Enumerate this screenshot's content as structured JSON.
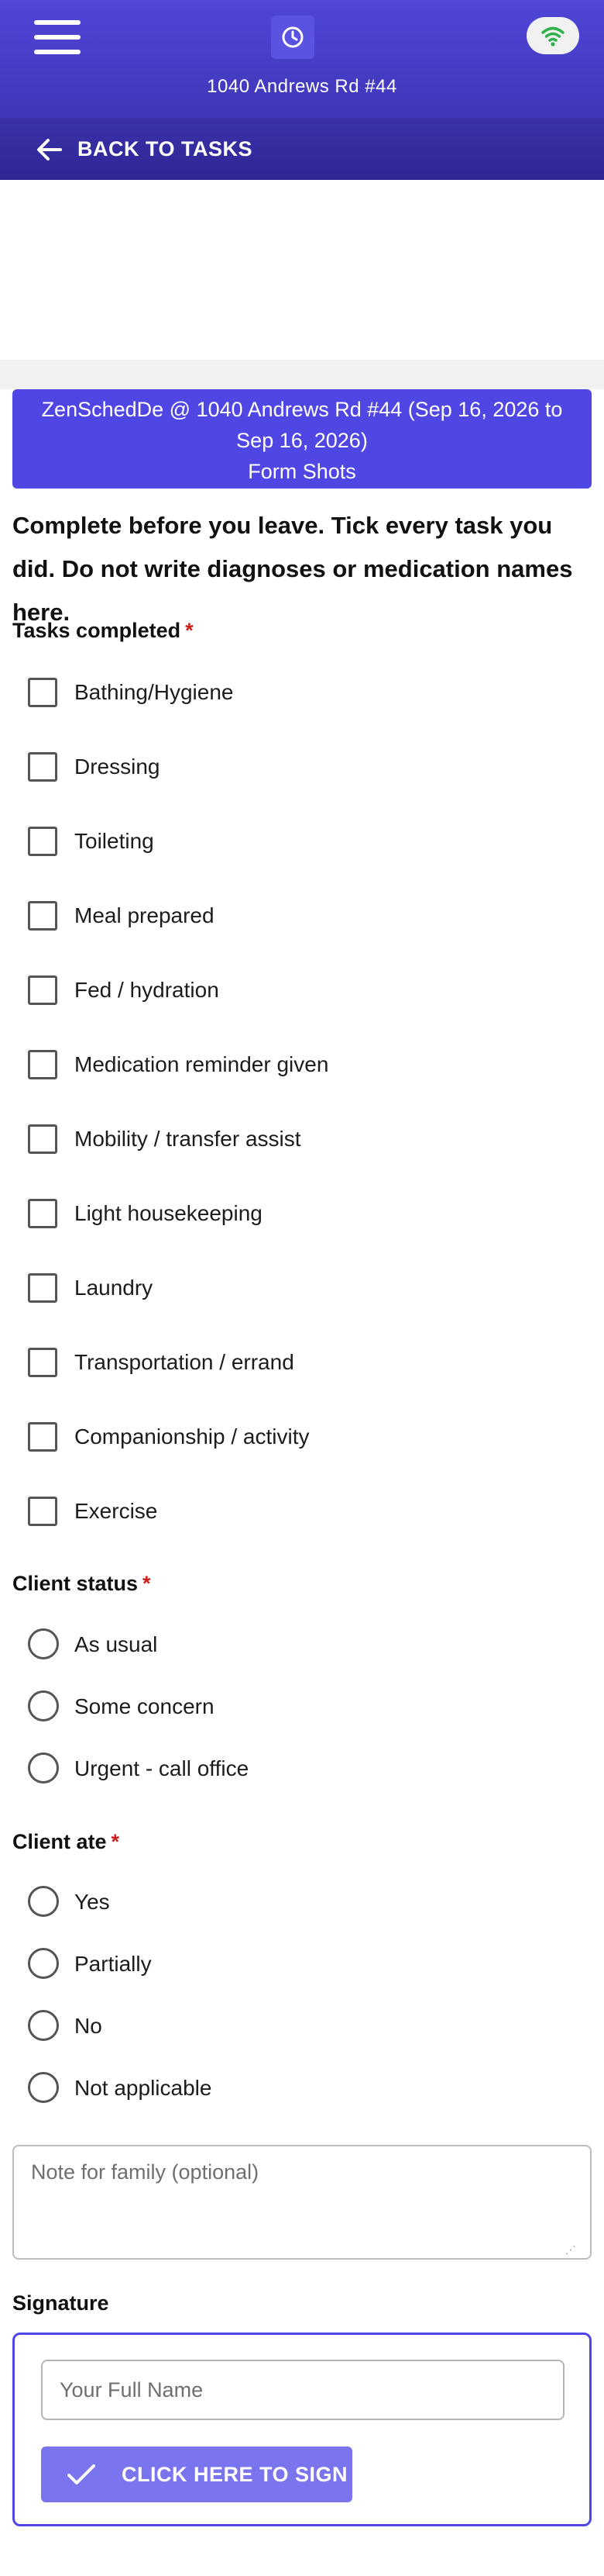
{
  "header": {
    "address": "1040 Andrews Rd #44",
    "menu_icon": "hamburger-menu-icon",
    "logo_icon": "clock-logo-icon",
    "status_icon": "wifi-icon",
    "status_color": "#2fb24c"
  },
  "nav": {
    "back_label": "BACK TO TASKS",
    "back_icon": "arrow-left-icon"
  },
  "banner": {
    "line1": "ZenSchedDe @ 1040 Andrews Rd #44 (Sep 16, 2026 to Sep 16, 2026)",
    "line2": "Form Shots",
    "color": "#5046e4"
  },
  "instructions": "Complete before you leave. Tick every task you did. Do not write diagnoses or medication names here.",
  "tasks": {
    "label": "Tasks completed",
    "required_mark": "*",
    "items": [
      "Bathing/Hygiene",
      "Dressing",
      "Toileting",
      "Meal prepared",
      "Fed / hydration",
      "Medication reminder given",
      "Mobility / transfer assist",
      "Light housekeeping",
      "Laundry",
      "Transportation / errand",
      "Companionship / activity",
      "Exercise"
    ]
  },
  "client_status": {
    "label": "Client status",
    "required_mark": "*",
    "options": [
      "As usual",
      "Some concern",
      "Urgent - call office"
    ]
  },
  "client_ate": {
    "label": "Client ate",
    "required_mark": "*",
    "options": [
      "Yes",
      "Partially",
      "No",
      "Not applicable"
    ]
  },
  "note": {
    "placeholder": "Note for family (optional)"
  },
  "signature": {
    "label": "Signature",
    "name_placeholder": "Your Full Name",
    "button_label": "CLICK HERE TO SIGN",
    "button_icon": "checkmark-icon",
    "accent": "#5046e4"
  }
}
